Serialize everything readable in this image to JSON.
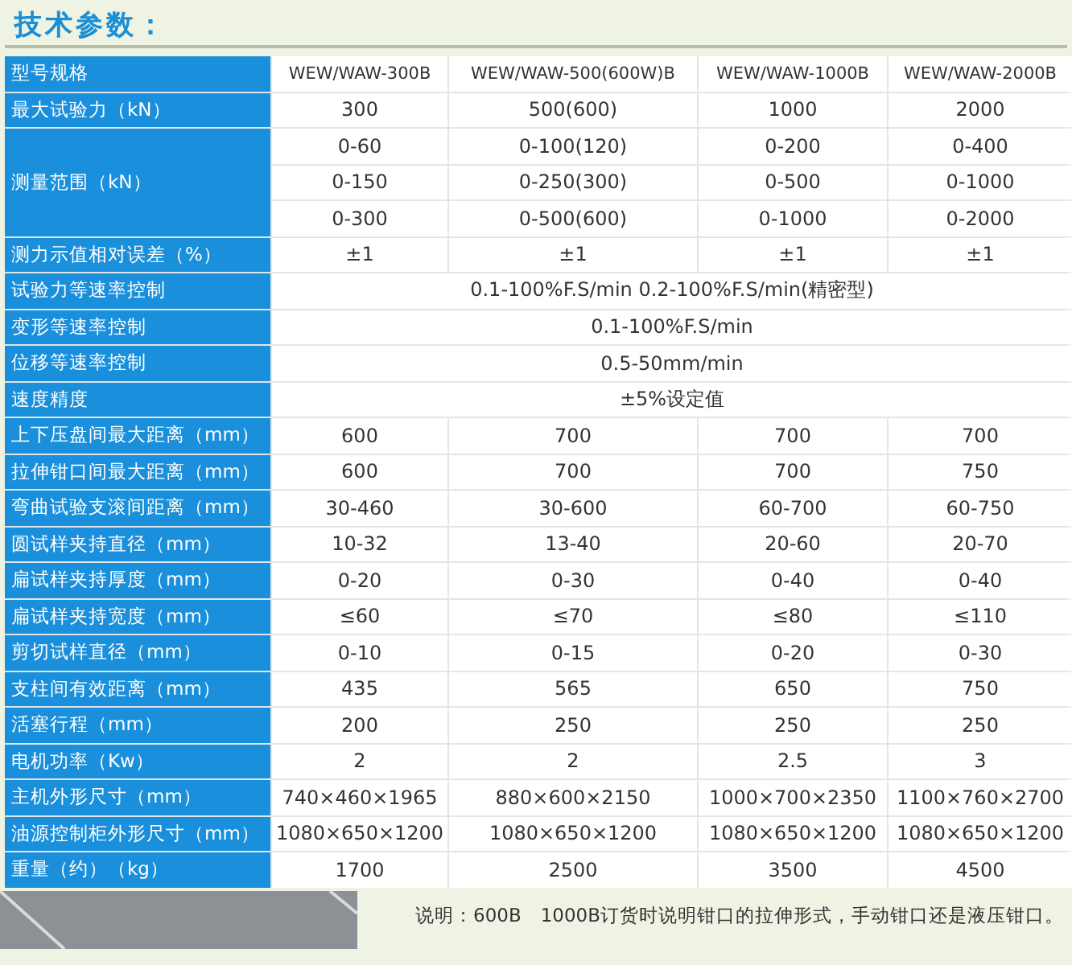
{
  "title": "技术参数：",
  "rows": [
    {
      "kind": "cells",
      "label": "型号规格",
      "values": [
        "WEW/WAW-300B",
        "WEW/WAW-500(600W)B",
        "WEW/WAW-1000B",
        "WEW/WAW-2000B"
      ]
    },
    {
      "kind": "cells",
      "label": "最大试验力（kN）",
      "values": [
        "300",
        "500(600)",
        "1000",
        "2000"
      ]
    },
    {
      "kind": "multi",
      "label": "测量范围（kN）",
      "lines": [
        [
          "0-60",
          "0-100(120)",
          "0-200",
          "0-400"
        ],
        [
          "0-150",
          "0-250(300)",
          "0-500",
          "0-1000"
        ],
        [
          "0-300",
          "0-500(600)",
          "0-1000",
          "0-2000"
        ]
      ]
    },
    {
      "kind": "cells",
      "label": "测力示值相对误差（%）",
      "values": [
        "±1",
        "±1",
        "±1",
        "±1"
      ]
    },
    {
      "kind": "span",
      "label": "试验力等速率控制",
      "value": "0.1-100%F.S/min  0.2-100%F.S/min(精密型)"
    },
    {
      "kind": "span",
      "label": "变形等速率控制",
      "value": "0.1-100%F.S/min"
    },
    {
      "kind": "span",
      "label": "位移等速率控制",
      "value": "0.5-50mm/min"
    },
    {
      "kind": "span",
      "label": "速度精度",
      "value": "±5%设定值"
    },
    {
      "kind": "cells",
      "label": "上下压盘间最大距离（mm）",
      "values": [
        "600",
        "700",
        "700",
        "700"
      ]
    },
    {
      "kind": "cells",
      "label": "拉伸钳口间最大距离（mm）",
      "values": [
        "600",
        "700",
        "700",
        "750"
      ]
    },
    {
      "kind": "cells",
      "label": "弯曲试验支滚间距离（mm）",
      "values": [
        "30-460",
        "30-600",
        "60-700",
        "60-750"
      ]
    },
    {
      "kind": "cells",
      "label": "圆试样夹持直径（mm）",
      "values": [
        "10-32",
        "13-40",
        "20-60",
        "20-70"
      ]
    },
    {
      "kind": "cells",
      "label": "扁试样夹持厚度（mm）",
      "values": [
        "0-20",
        "0-30",
        "0-40",
        "0-40"
      ]
    },
    {
      "kind": "cells",
      "label": "扁试样夹持宽度（mm）",
      "values": [
        "≤60",
        "≤70",
        "≤80",
        "≤110"
      ]
    },
    {
      "kind": "cells",
      "label": "剪切试样直径（mm）",
      "values": [
        "0-10",
        "0-15",
        "0-20",
        "0-30"
      ]
    },
    {
      "kind": "cells",
      "label": "支柱间有效距离（mm）",
      "values": [
        "435",
        "565",
        "650",
        "750"
      ]
    },
    {
      "kind": "cells",
      "label": "活塞行程（mm）",
      "values": [
        "200",
        "250",
        "250",
        "250"
      ]
    },
    {
      "kind": "cells",
      "label": "电机功率（Kw）",
      "values": [
        "2",
        "2",
        "2.5",
        "3"
      ]
    },
    {
      "kind": "cells",
      "label": "主机外形尺寸（mm）",
      "values": [
        "740×460×1965",
        "880×600×2150",
        "1000×700×2350",
        "1100×760×2700"
      ]
    },
    {
      "kind": "cells",
      "label": "油源控制柜外形尺寸（mm）",
      "values": [
        "1080×650×1200",
        "1080×650×1200",
        "1080×650×1200",
        "1080×650×1200"
      ]
    },
    {
      "kind": "cells",
      "label": "重量（约）（kg）",
      "values": [
        "1700",
        "2500",
        "3500",
        "4500"
      ]
    }
  ],
  "note": "说明：600B　1000B订货时说明钳口的拉伸形式，手动钳口还是液压钳口。"
}
